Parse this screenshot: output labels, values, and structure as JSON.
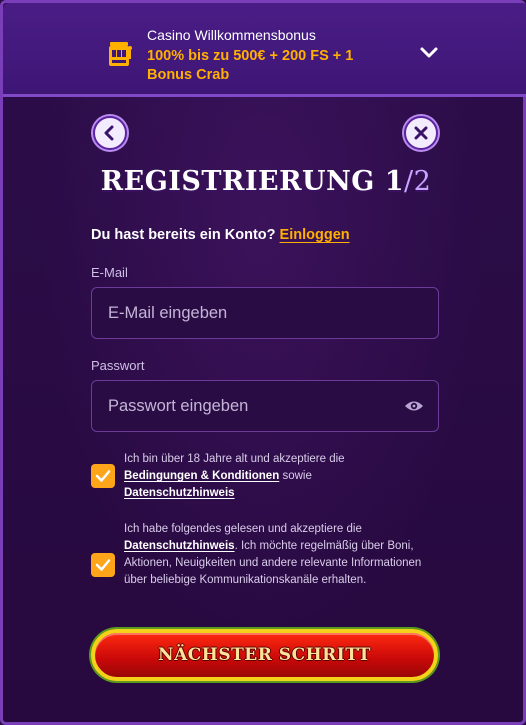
{
  "banner": {
    "caption": "Casino Willkommensbonus",
    "offer": "100% bis zu 500€ + 200 FS + 1 Bonus Crab",
    "icon": "slot-machine-icon",
    "toggle_icon": "chevron-down-icon"
  },
  "nav": {
    "back_icon": "chevron-left-icon",
    "close_icon": "close-icon"
  },
  "title": {
    "text": "REGISTRIERUNG 1",
    "step": "/2"
  },
  "login": {
    "prompt": "Du hast bereits ein Konto?",
    "link": "Einloggen"
  },
  "form": {
    "email_label": "E-Mail",
    "email_placeholder": "E-Mail eingeben",
    "email_value": "",
    "password_label": "Passwort",
    "password_placeholder": "Passwort eingeben",
    "password_value": "",
    "password_toggle_icon": "eye-icon"
  },
  "consent_terms": {
    "checked": true,
    "text_before": "Ich bin über 18 Jahre alt und akzeptiere die",
    "link1": "Bedingungen & Konditionen",
    "text_middle": "sowie",
    "link2": "Datenschutzhinweis"
  },
  "consent_marketing": {
    "checked": true,
    "text_before": "Ich habe folgendes gelesen und akzeptiere die",
    "link": "Datenschutzhinweis",
    "text_after": ". Ich möchte regelmäßig über Boni, Aktionen, Neuigkeiten und andere relevante Informationen über beliebige Kommunikationskanäle erhalten."
  },
  "next_button": {
    "label": "NÄCHSTER SCHRITT"
  },
  "colors": {
    "accent": "#ffb000",
    "checkbox": "#ffa51a",
    "button_red": "#d80c0c",
    "button_border": "#f4d21a",
    "background": "#2a0d45"
  }
}
